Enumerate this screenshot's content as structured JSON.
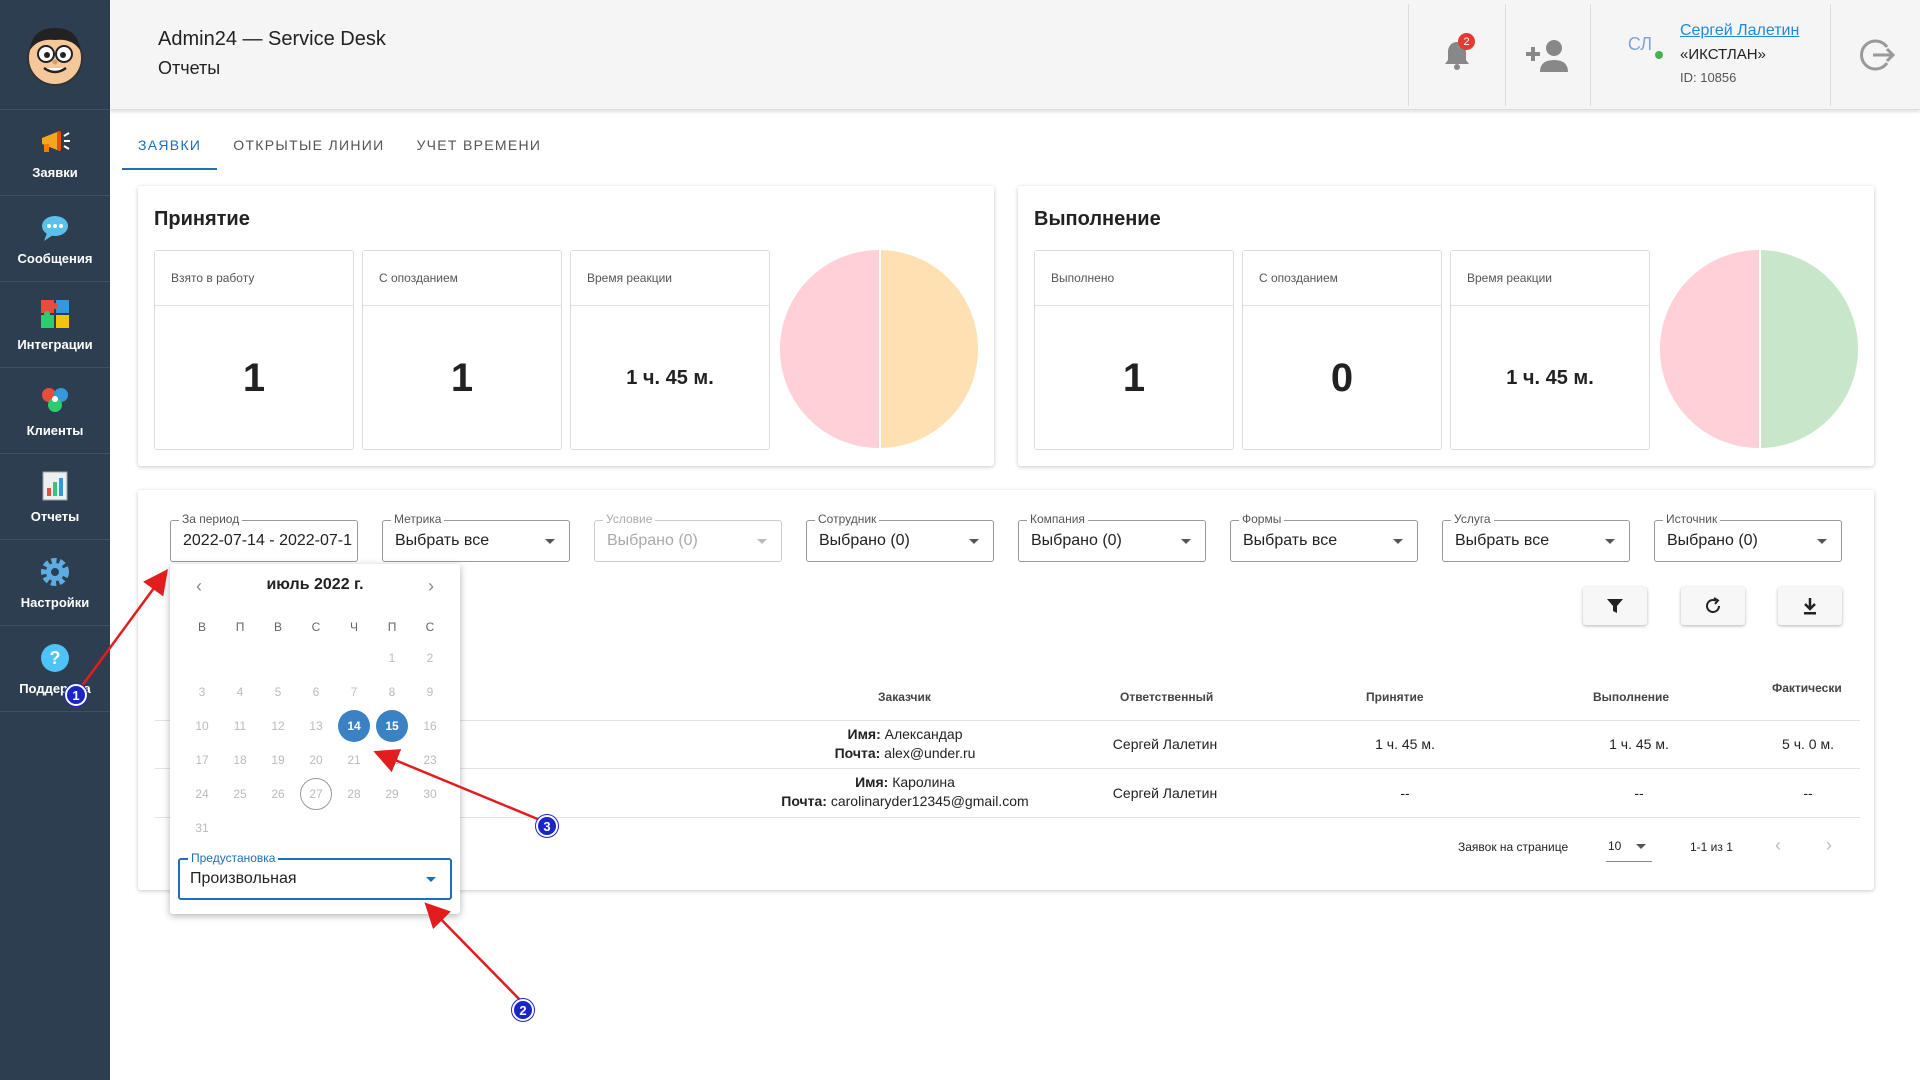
{
  "app": {
    "title": "Admin24 — Service Desk",
    "subtitle": "Отчеты"
  },
  "sidebar": {
    "items": [
      {
        "label": "Заявки",
        "icon": "megaphone-icon"
      },
      {
        "label": "Сообщения",
        "icon": "chat-icon"
      },
      {
        "label": "Интеграции",
        "icon": "puzzle-icon"
      },
      {
        "label": "Клиенты",
        "icon": "clients-icon"
      },
      {
        "label": "Отчеты",
        "icon": "report-icon"
      },
      {
        "label": "Настройки",
        "icon": "gear-icon"
      },
      {
        "label": "Поддержка",
        "icon": "help-icon"
      }
    ]
  },
  "header": {
    "notifications_count": "2",
    "user": {
      "initials": "СЛ",
      "name": "Сергей Лалетин",
      "company": "«ИКСТЛАН»",
      "id": "ID: 10856"
    }
  },
  "tabs": [
    "ЗАЯВКИ",
    "ОТКРЫТЫЕ ЛИНИИ",
    "УЧЕТ ВРЕМЕНИ"
  ],
  "acceptance": {
    "title": "Принятие",
    "stats": [
      {
        "label": "Взято в работу",
        "value": "1"
      },
      {
        "label": "С опозданием",
        "value": "1"
      },
      {
        "label": "Время реакции",
        "value": "1 ч. 45 м."
      }
    ],
    "pie_colors": [
      "#ffd0d6",
      "#ffe0b2"
    ]
  },
  "completion": {
    "title": "Выполнение",
    "stats": [
      {
        "label": "Выполнено",
        "value": "1"
      },
      {
        "label": "С опозданием",
        "value": "0"
      },
      {
        "label": "Время реакции",
        "value": "1 ч. 45 м."
      }
    ],
    "pie_colors": [
      "#ffd0d6",
      "#c8e6c9"
    ]
  },
  "filters": [
    {
      "label": "За период",
      "value": "2022-07-14 - 2022-07-1"
    },
    {
      "label": "Метрика",
      "value": "Выбрать все"
    },
    {
      "label": "Условие",
      "value": "Выбрано (0)"
    },
    {
      "label": "Сотрудник",
      "value": "Выбрано (0)"
    },
    {
      "label": "Компания",
      "value": "Выбрано (0)"
    },
    {
      "label": "Формы",
      "value": "Выбрать все"
    },
    {
      "label": "Услуга",
      "value": "Выбрать все"
    },
    {
      "label": "Источник",
      "value": "Выбрано (0)"
    }
  ],
  "table": {
    "headers": {
      "customer": "Заказчик",
      "responsible": "Ответственный",
      "acceptance": "Принятие",
      "completion": "Выполнение",
      "actual": "Фактически"
    },
    "rows": [
      {
        "name_label": "Имя:",
        "name": "Александар",
        "email_label": "Почта:",
        "email": "alex@under.ru",
        "responsible": "Сергей Лалетин",
        "acceptance": "1 ч. 45 м.",
        "completion": "1 ч. 45 м.",
        "actual": "5 ч. 0 м."
      },
      {
        "name_label": "Имя:",
        "name": "Каролина",
        "email_label": "Почта:",
        "email": "carolinaryder12345@gmail.com",
        "responsible": "Сергей Лалетин",
        "acceptance": "--",
        "completion": "--",
        "actual": "--"
      }
    ],
    "pagination": {
      "per_page_label": "Заявок на странице",
      "per_page": "10",
      "range": "1-1 из 1"
    }
  },
  "calendar": {
    "title": "июль 2022 г.",
    "weekdays": [
      "В",
      "П",
      "В",
      "С",
      "Ч",
      "П",
      "С"
    ],
    "preset_label": "Предустановка",
    "preset_value": "Произвольная"
  },
  "markers": [
    "1",
    "2",
    "3"
  ]
}
